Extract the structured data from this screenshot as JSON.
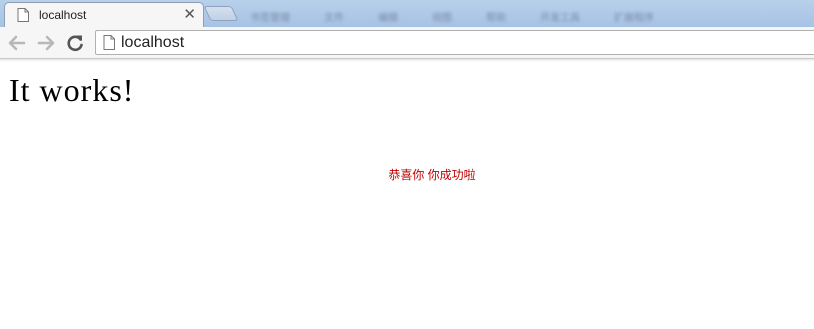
{
  "tab": {
    "title": "localhost",
    "close_glyph": "✕"
  },
  "tabstrip_background": [
    "书签管理",
    "文件",
    "编辑",
    "视图",
    "帮助",
    "开发工具",
    "扩展程序"
  ],
  "address_bar": {
    "url": "localhost"
  },
  "page": {
    "heading": "It works!",
    "message": "恭喜你 你成功啦",
    "message_color": "#c00000"
  },
  "icons": {
    "back": "arrow-left-icon",
    "forward": "arrow-right-icon",
    "reload": "reload-icon",
    "page": "page-icon"
  }
}
